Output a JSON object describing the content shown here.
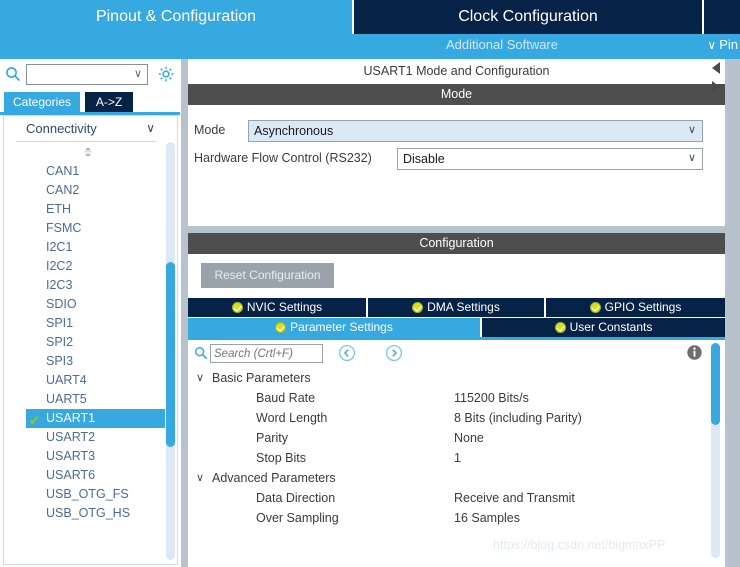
{
  "topbar": {
    "tabs": [
      {
        "label": "Pinout & Configuration",
        "state": "inactive"
      },
      {
        "label": "Clock Configuration",
        "state": "active"
      },
      {
        "label": "",
        "state": "stub"
      }
    ],
    "additional_software": "Additional Software",
    "pinout_stub": "Pin",
    "pinout_chevron": "∨"
  },
  "sidebar": {
    "search": {
      "value": "",
      "chevron": "∨"
    },
    "icons": {
      "search": "search-icon",
      "gear": "gear-icon"
    },
    "tabs": [
      {
        "label": "Categories",
        "state": "active"
      },
      {
        "label": "A->Z",
        "state": "inactive"
      }
    ],
    "category": {
      "label": "Connectivity",
      "chevron": "∨"
    },
    "peripherals": [
      {
        "label": "CAN1",
        "selected": false
      },
      {
        "label": "CAN2",
        "selected": false
      },
      {
        "label": "ETH",
        "selected": false
      },
      {
        "label": "FSMC",
        "selected": false
      },
      {
        "label": "I2C1",
        "selected": false
      },
      {
        "label": "I2C2",
        "selected": false
      },
      {
        "label": "I2C3",
        "selected": false
      },
      {
        "label": "SDIO",
        "selected": false
      },
      {
        "label": "SPI1",
        "selected": false
      },
      {
        "label": "SPI2",
        "selected": false
      },
      {
        "label": "SPI3",
        "selected": false
      },
      {
        "label": "UART4",
        "selected": false
      },
      {
        "label": "UART5",
        "selected": false
      },
      {
        "label": "USART1",
        "selected": true,
        "tick": "✔"
      },
      {
        "label": "USART2",
        "selected": false
      },
      {
        "label": "USART3",
        "selected": false
      },
      {
        "label": "USART6",
        "selected": false
      },
      {
        "label": "USB_OTG_FS",
        "selected": false
      },
      {
        "label": "USB_OTG_HS",
        "selected": false
      }
    ]
  },
  "main": {
    "panel_title": "USART1 Mode and Configuration",
    "mode": {
      "header": "Mode",
      "rows": [
        {
          "label": "Mode",
          "value": "Asynchronous",
          "chevron": "∨"
        },
        {
          "label": "Hardware Flow Control (RS232)",
          "value": "Disable",
          "chevron": "∨"
        }
      ]
    },
    "configuration": {
      "header": "Configuration",
      "reset_label": "Reset Configuration",
      "tabs_row1": [
        {
          "label": "NVIC Settings",
          "active": false
        },
        {
          "label": "DMA Settings",
          "active": false
        },
        {
          "label": "GPIO Settings",
          "active": false
        }
      ],
      "tabs_row2": [
        {
          "label": "Parameter Settings",
          "active": true
        },
        {
          "label": "User Constants",
          "active": false
        }
      ],
      "toolbar": {
        "search_placeholder": "Search (Crtl+F)",
        "search_value": "",
        "back_icon": "chevron-left-circle-icon",
        "forward_icon": "chevron-right-circle-icon",
        "info_icon": "info-icon"
      },
      "tree": [
        {
          "group": "Basic Parameters",
          "chevron": "∨",
          "params": [
            {
              "name": "Baud Rate",
              "value": "115200 Bits/s"
            },
            {
              "name": "Word Length",
              "value": "8 Bits (including Parity)"
            },
            {
              "name": "Parity",
              "value": "None"
            },
            {
              "name": "Stop Bits",
              "value": "1"
            }
          ]
        },
        {
          "group": "Advanced Parameters",
          "chevron": "∨",
          "params": [
            {
              "name": "Data Direction",
              "value": "Receive and Transmit"
            },
            {
              "name": "Over Sampling",
              "value": "16 Samples"
            }
          ]
        }
      ]
    }
  },
  "watermark": "https://blog.csdn.net/bigmaxPP",
  "colors": {
    "accent_blue": "#36a9e0",
    "dark_navy": "#072247",
    "header_gray": "#4e4e4e",
    "check_green": "#87c523",
    "tab_check": "#d4e02a"
  }
}
